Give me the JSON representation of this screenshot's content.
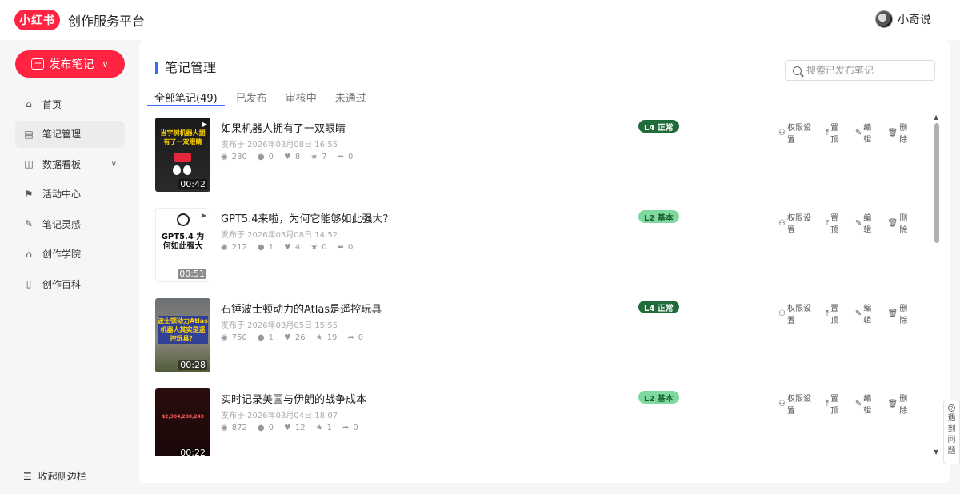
{
  "header": {
    "logo": "小红书",
    "platform_title": "创作服务平台",
    "user_name": "小奇说"
  },
  "sidebar": {
    "publish_label": "发布笔记",
    "items": [
      {
        "label": "首页",
        "icon": "home-icon"
      },
      {
        "label": "笔记管理",
        "icon": "note-icon",
        "active": true
      },
      {
        "label": "数据看板",
        "icon": "chart-icon"
      },
      {
        "label": "活动中心",
        "icon": "flag-icon"
      },
      {
        "label": "笔记灵感",
        "icon": "bulb-icon"
      },
      {
        "label": "创作学院",
        "icon": "academy-icon"
      },
      {
        "label": "创作百科",
        "icon": "book-icon"
      }
    ],
    "collapse_label": "收起侧边栏"
  },
  "main": {
    "title": "笔记管理",
    "search_placeholder": "搜索已发布笔记",
    "tabs": [
      "全部笔记(49)",
      "已发布",
      "审核中",
      "未通过"
    ],
    "actions": [
      "权限设置",
      "置顶",
      "编辑",
      "删除"
    ],
    "notes": [
      {
        "title": "如果机器人拥有了一双眼睛",
        "time": "发布于 2026年03月08日 16:55",
        "views": "230",
        "comments": "0",
        "likes": "8",
        "collects": "7",
        "shares": "0",
        "badge": "L4 正常",
        "badge_style": "dark",
        "duration": "00:42",
        "thumb_caption": "当宇树机器人拥有了一双眼睛"
      },
      {
        "title": "GPT5.4来啦，为何它能够如此强大？",
        "time": "发布于 2026年03月08日 14:52",
        "views": "212",
        "comments": "1",
        "likes": "4",
        "collects": "0",
        "shares": "0",
        "badge": "L2 基本",
        "badge_style": "light",
        "duration": "00:51",
        "thumb_caption": "GPT5.4 为何如此强大"
      },
      {
        "title": "石锤波士顿动力的Atlas是遥控玩具",
        "time": "发布于 2026年03月05日 15:55",
        "views": "750",
        "comments": "1",
        "likes": "26",
        "collects": "19",
        "shares": "0",
        "badge": "L4 正常",
        "badge_style": "dark",
        "duration": "00:28",
        "thumb_caption": "波士顿动力Atlas机器人其实是遥控玩具？"
      },
      {
        "title": "实时记录美国与伊朗的战争成本",
        "time": "发布于 2026年03月04日 18:07",
        "views": "872",
        "comments": "0",
        "likes": "12",
        "collects": "1",
        "shares": "0",
        "badge": "L2 基本",
        "badge_style": "light",
        "duration": "00:22",
        "thumb_caption": "$2,304,238,243"
      }
    ]
  },
  "help_label": [
    "遇",
    "到",
    "问",
    "题"
  ],
  "colors": {
    "brand": "#ff2442",
    "accent": "#3b6cf6"
  }
}
